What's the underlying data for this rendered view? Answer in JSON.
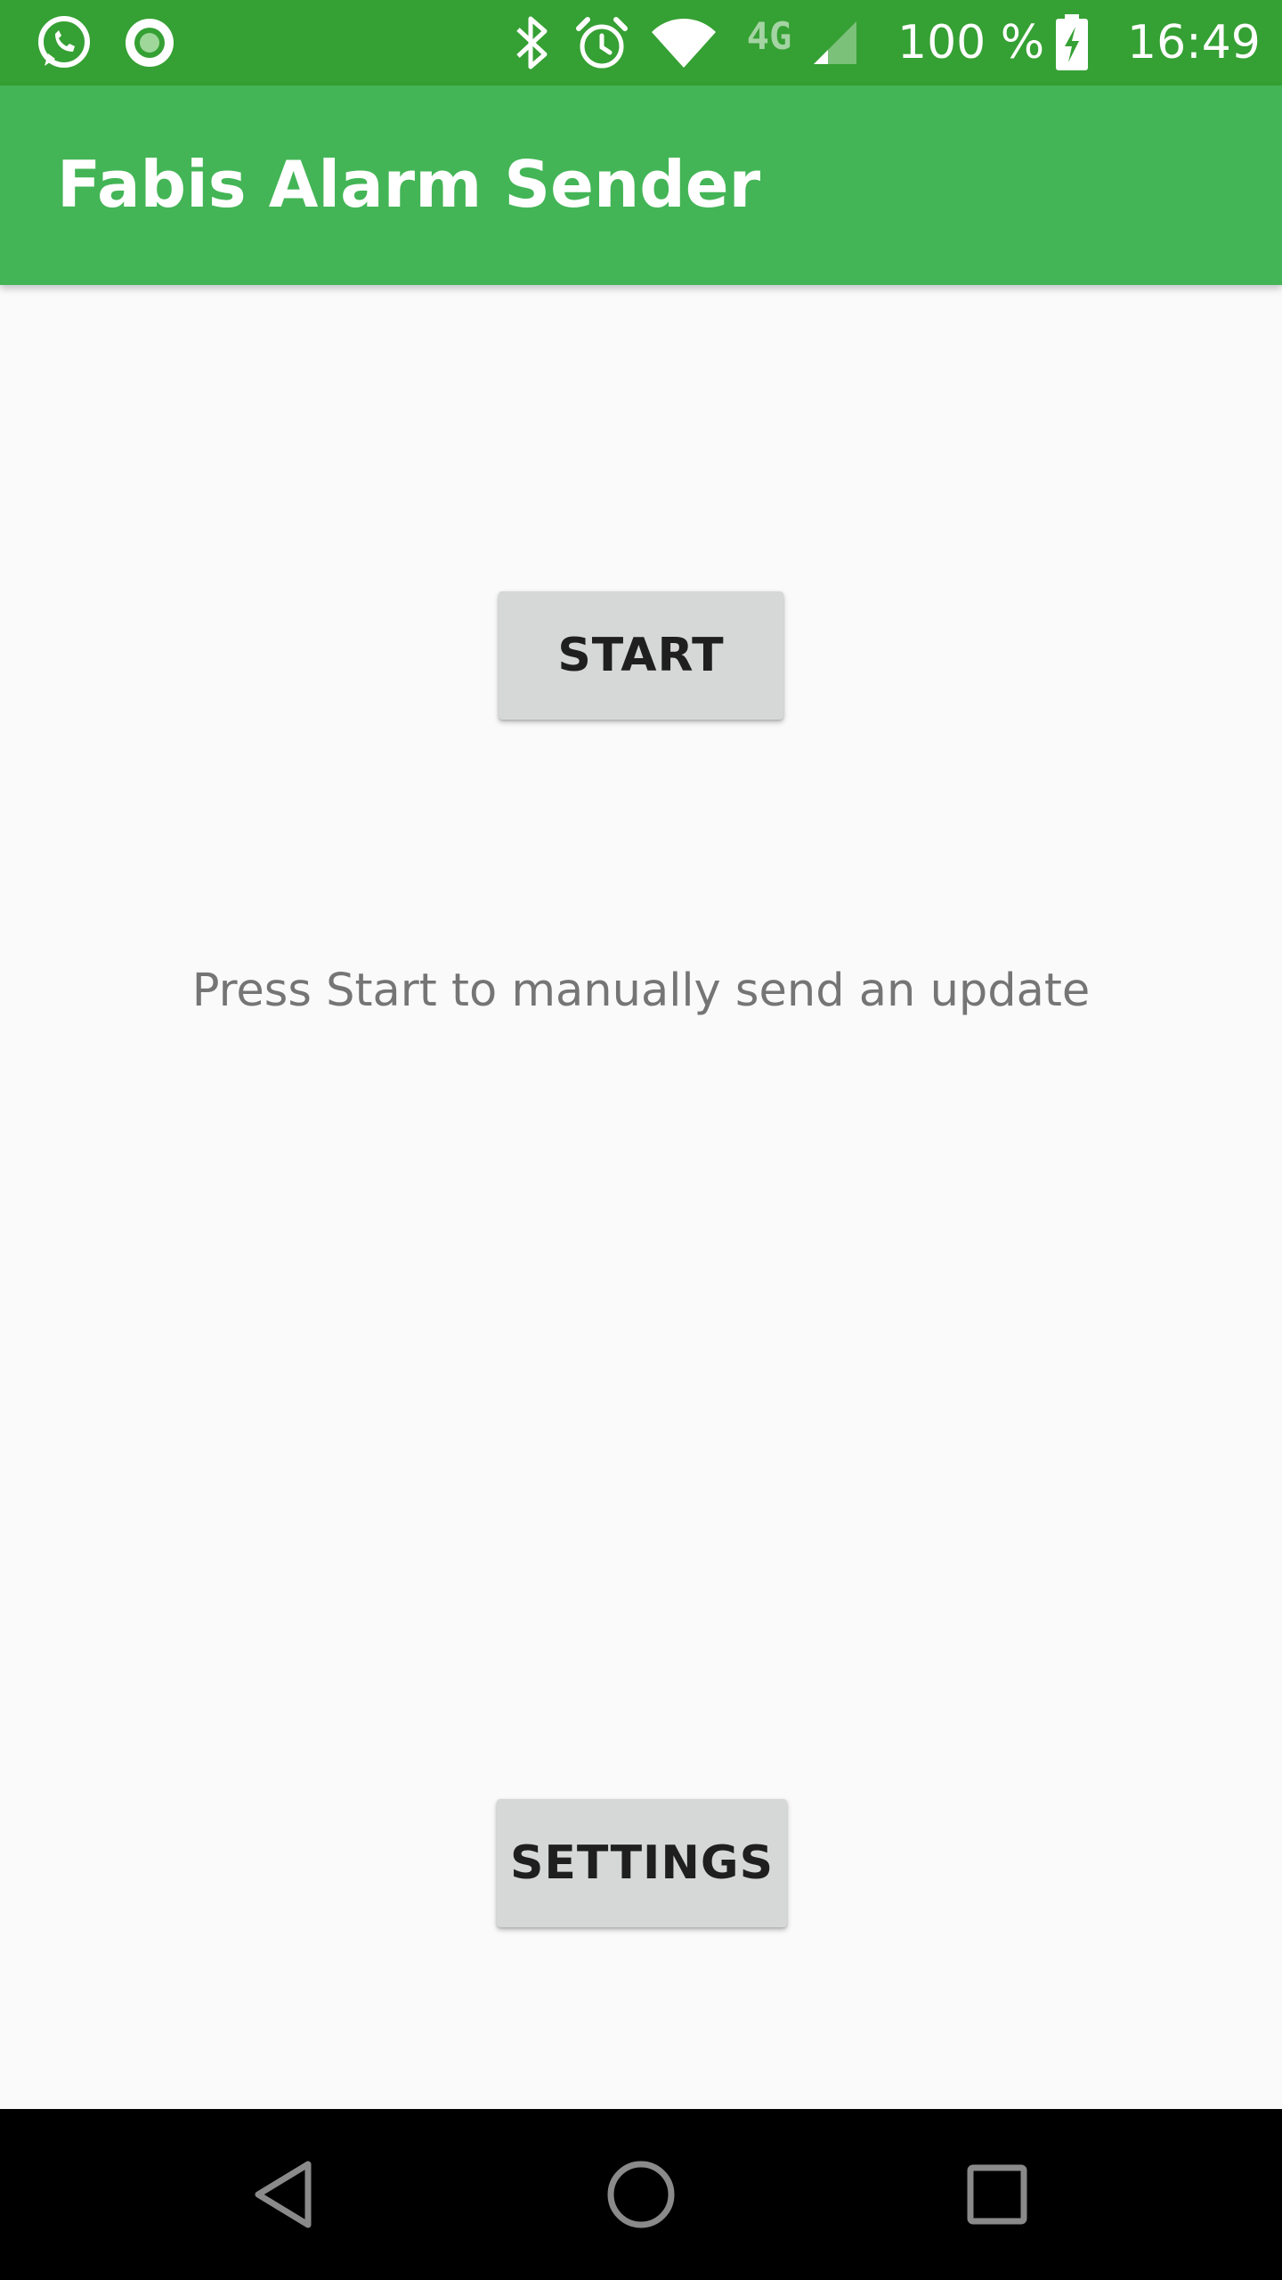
{
  "status_bar": {
    "battery_percent": "100 %",
    "time": "16:49",
    "network_type": "4G",
    "icons": {
      "left": [
        "whatsapp-icon",
        "circle-notification-icon"
      ],
      "right": [
        "bluetooth-icon",
        "alarm-icon",
        "wifi-icon",
        "network-4g-icon",
        "cellular-signal-icon",
        "battery-charging-icon"
      ]
    },
    "color": "#35a033"
  },
  "app_bar": {
    "title": "Fabis Alarm Sender",
    "color": "#43b556"
  },
  "main": {
    "start_button_label": "START",
    "hint_text": "Press Start to manually send an update",
    "settings_button_label": "SETTINGS"
  },
  "nav_bar": {
    "icons": [
      "back-icon",
      "home-icon",
      "recents-icon"
    ]
  }
}
